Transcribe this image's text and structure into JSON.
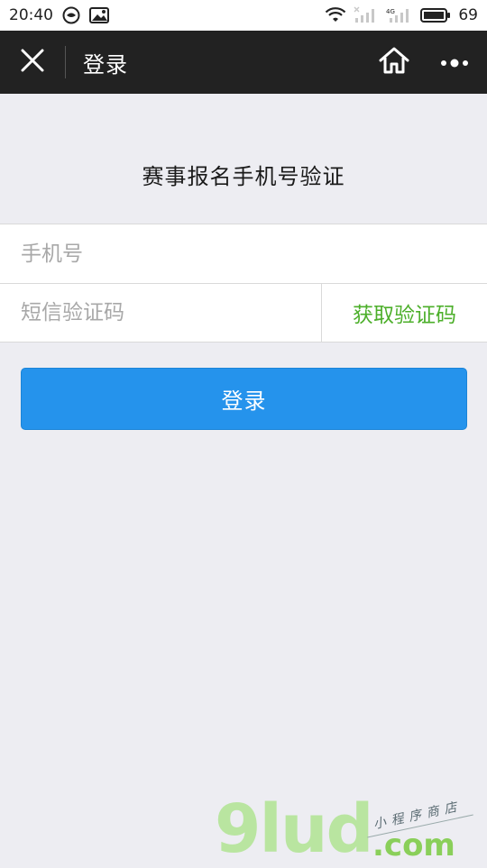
{
  "status_bar": {
    "time": "20:40",
    "network_label": "4G",
    "battery_level": "69"
  },
  "nav": {
    "title": "登录"
  },
  "page": {
    "heading": "赛事报名手机号验证"
  },
  "form": {
    "phone_placeholder": "手机号",
    "code_placeholder": "短信验证码",
    "get_code_label": "获取验证码",
    "login_label": "登录"
  },
  "watermark": {
    "brand": "9lud",
    "subtitle": "小程序商店",
    "domain": ".com"
  },
  "colors": {
    "nav_bg": "#222222",
    "page_bg": "#ededf2",
    "primary_button": "#2593ec",
    "get_code_text": "#4caf2a"
  },
  "icons": {
    "close": "close-icon",
    "home": "home-icon",
    "more": "more-icon"
  }
}
